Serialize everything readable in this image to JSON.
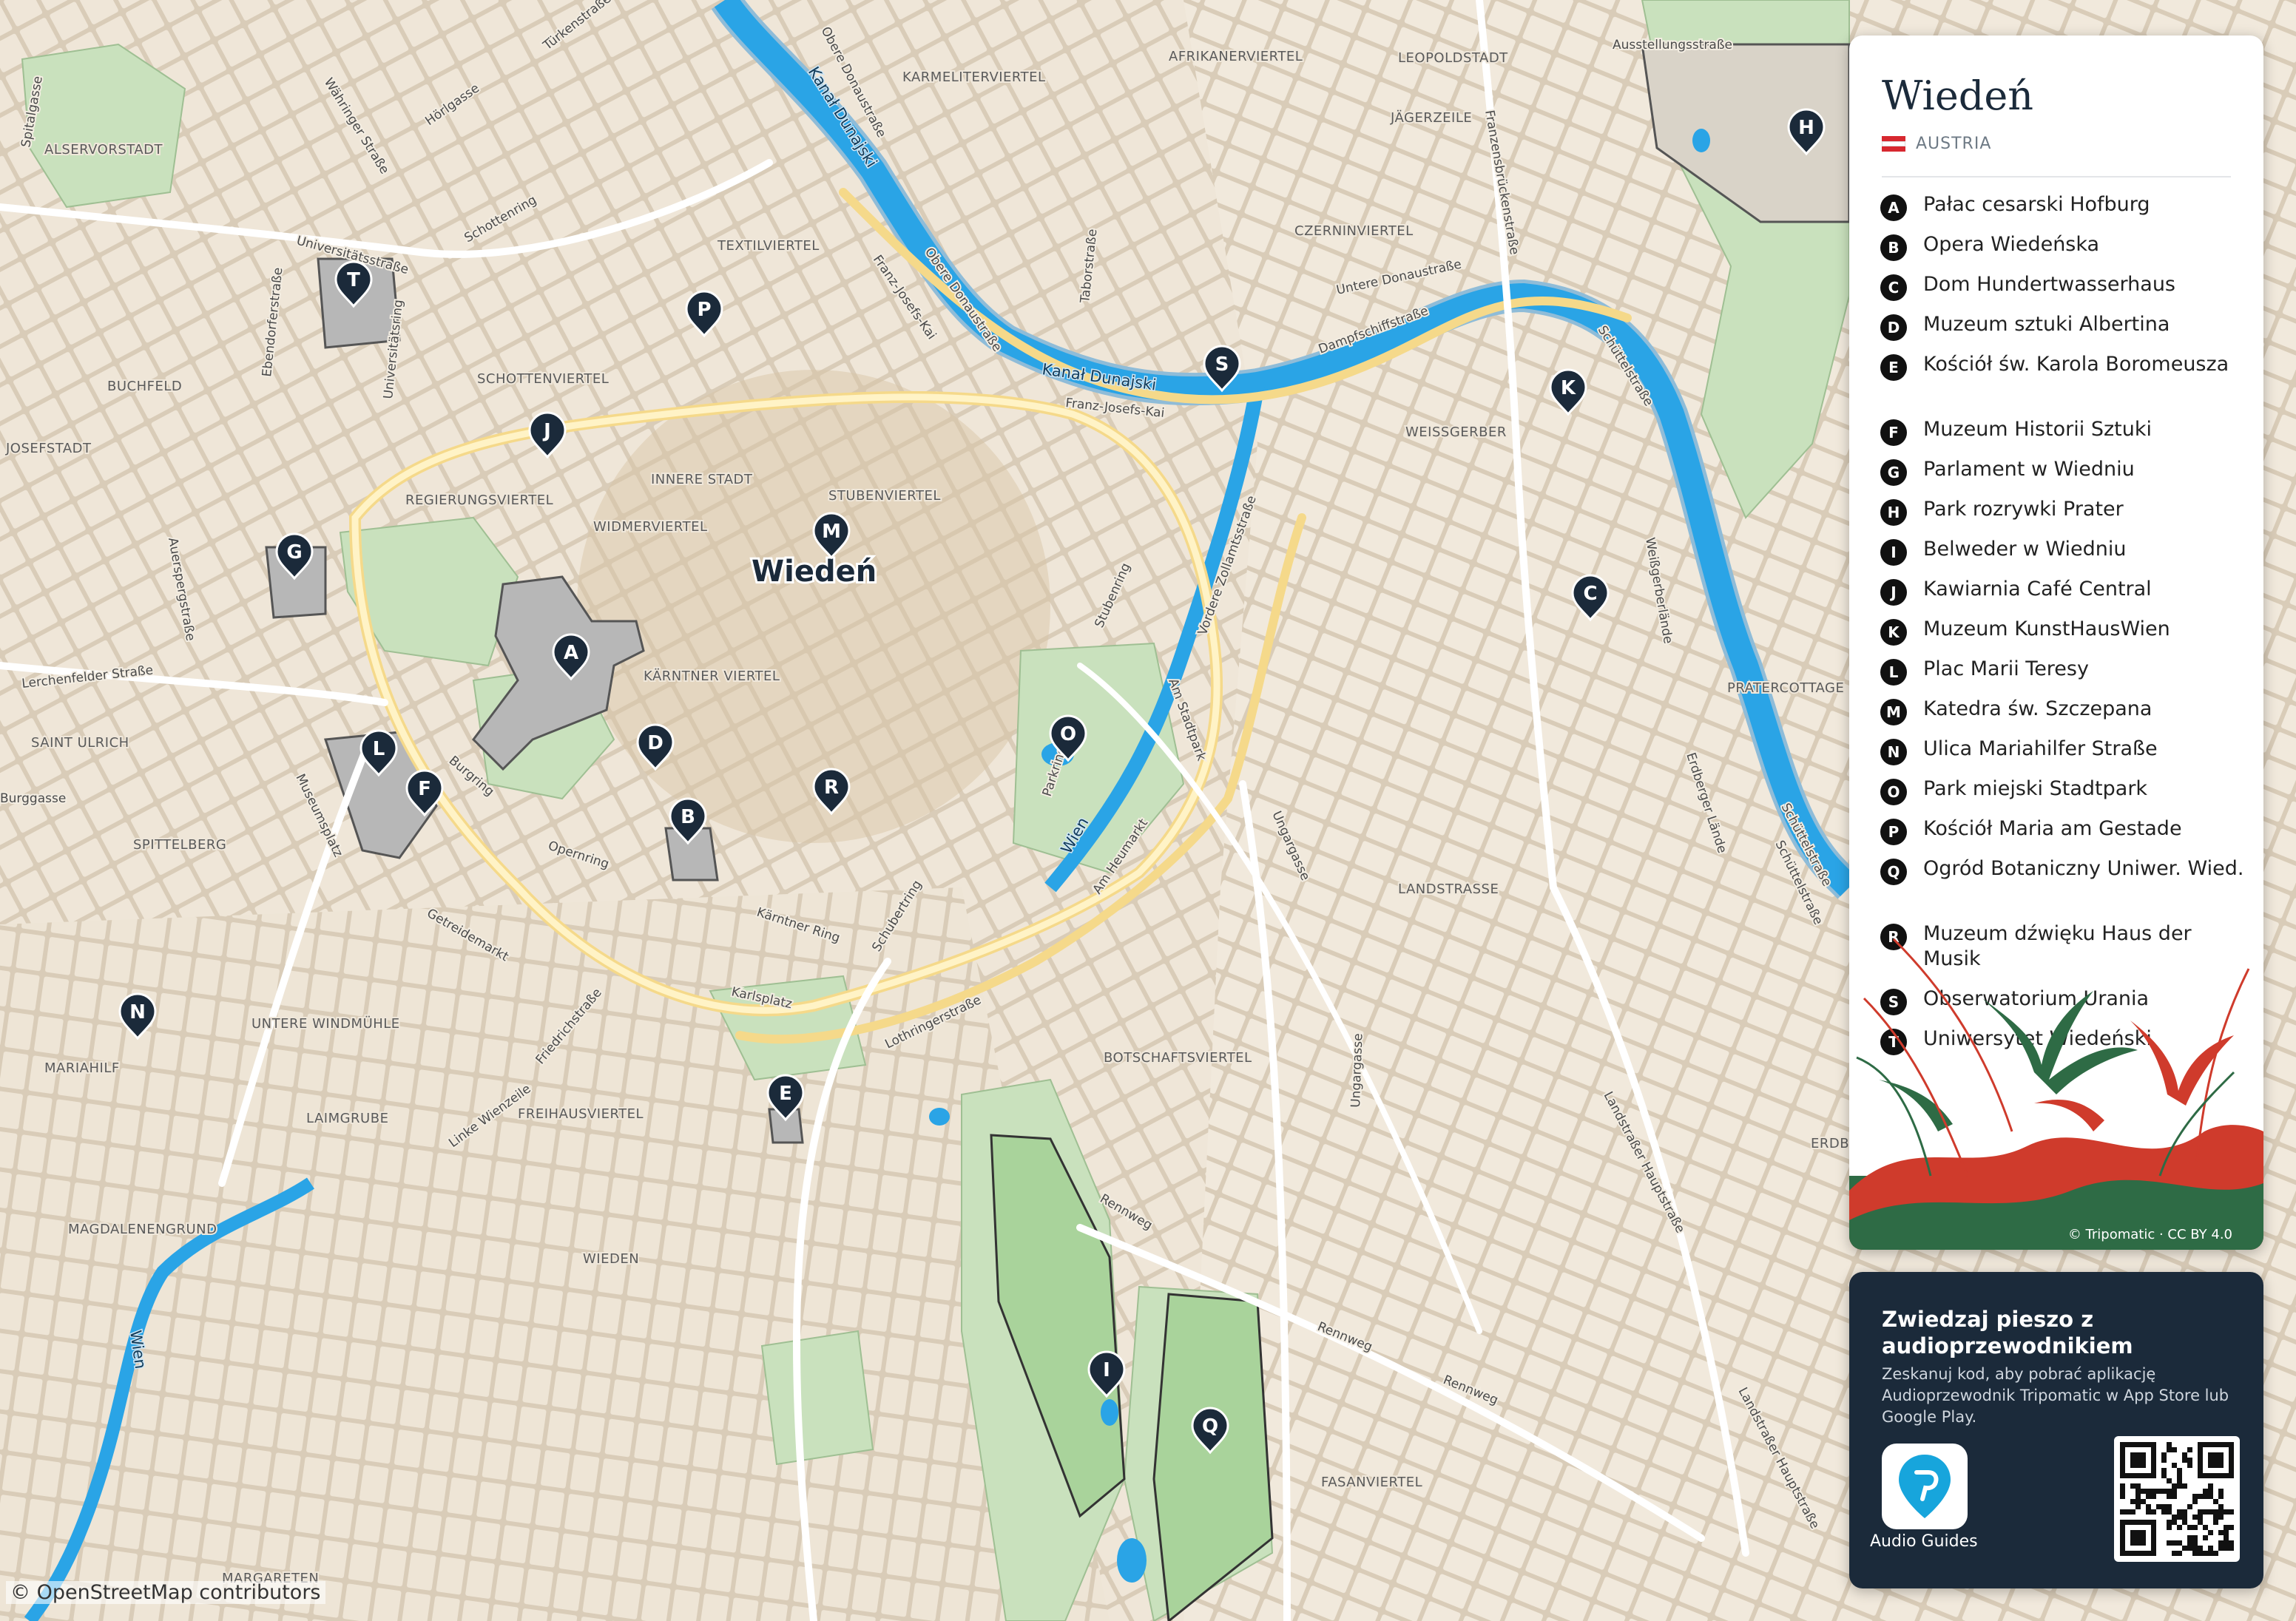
{
  "map": {
    "city_label": "Wiedeń",
    "attribution": "© OpenStreetMap contributors",
    "water_labels": [
      "Kanał Dunajski",
      "Kanał Dunajski",
      "Wien",
      "Wien"
    ],
    "district_labels": [
      "ALSERVORSTADT",
      "KARMELITERVIERTEL",
      "AFRIKANERVIERTEL",
      "LEOPOLDSTADT",
      "JÄGERZEILE",
      "TEXTILVIERTEL",
      "CZERNINVIERTEL",
      "BUCHFELD",
      "SCHOTTENVIERTEL",
      "JOSEFSTADT",
      "INNERE STADT",
      "WEISSGERBER",
      "REGIERUNGSVIERTEL",
      "STUBENVIERTEL",
      "WIDMERVIERTEL",
      "KÄRNTNER VIERTEL",
      "SAINT ULRICH",
      "SPITTELBERG",
      "LANDSTRASSE",
      "PRATERCOTTAGE",
      "UNTERE WINDMÜHLE",
      "MARIAHILF",
      "BOTSCHAFTSVIERTEL",
      "LAIMGRUBE",
      "FREIHAUSVIERTEL",
      "MAGDALENENGRUND",
      "WIEDEN",
      "FASANVIERTEL",
      "MARGARETEN",
      "ERDBE"
    ],
    "street_labels": [
      "Spitalgasse",
      "Türkenstraße",
      "Hörlgasse",
      "Obere Donaustraße",
      "Währinger Straße",
      "Universitätsstraße",
      "Schottenring",
      "Ebendorferstraße",
      "Universitätsring",
      "Franz-Josefs-Kai",
      "Obere Donaustraße",
      "Taborstraße",
      "Untere Donaustraße",
      "Franzensbrückenstraße",
      "Ausstellungsstraße",
      "Dampfschiffstraße",
      "Franz-Josefs-Kai",
      "Schüttelstraße",
      "Weißgerberlände",
      "Auerspergstraße",
      "Lerchenfelder Straße",
      "Parkring",
      "Stubenring",
      "Vordere Zollamtsstraße",
      "Am Stadtpark",
      "Burgring",
      "Museumsplatz",
      "Opernring",
      "Kärntner Ring",
      "Schubertring",
      "Am Heumarkt",
      "Ungargasse",
      "Getreidemarkt",
      "Friedrichstraße",
      "Karlsplatz",
      "Lothringerstraße",
      "Linke Wienzeile",
      "Schüttelstraße",
      "Erdberger Lände",
      "Rennweg",
      "Rennweg",
      "Rennweg",
      "Ungargasse",
      "Landstraßer Hauptstraße",
      "Landstraßer Hauptstraße",
      "Schüttelstraße",
      "Burggasse"
    ],
    "pins": [
      {
        "letter": "A"
      },
      {
        "letter": "B"
      },
      {
        "letter": "C"
      },
      {
        "letter": "D"
      },
      {
        "letter": "E"
      },
      {
        "letter": "F"
      },
      {
        "letter": "G"
      },
      {
        "letter": "H"
      },
      {
        "letter": "I"
      },
      {
        "letter": "J"
      },
      {
        "letter": "K"
      },
      {
        "letter": "L"
      },
      {
        "letter": "M"
      },
      {
        "letter": "N"
      },
      {
        "letter": "O"
      },
      {
        "letter": "P"
      },
      {
        "letter": "Q"
      },
      {
        "letter": "R"
      },
      {
        "letter": "S"
      },
      {
        "letter": "T"
      }
    ],
    "colors": {
      "land": "#e6dccd",
      "block": "#f3ede2",
      "park": "#cfe5c4",
      "water": "#2aa4e6",
      "road": "#ffffff",
      "major_road": "#fde9a8",
      "pin": "#1b2a3a"
    }
  },
  "panel": {
    "title": "Wiedeń",
    "country": "AUSTRIA",
    "flag_colors": [
      "#d7282f",
      "#ffffff",
      "#d7282f"
    ],
    "credit": "© Tripomatic · CC BY 4.0",
    "pois": [
      {
        "letter": "A",
        "name": "Pałac cesarski Hofburg"
      },
      {
        "letter": "B",
        "name": "Opera Wiedeńska"
      },
      {
        "letter": "C",
        "name": "Dom Hundertwasserhaus"
      },
      {
        "letter": "D",
        "name": "Muzeum sztuki Albertina"
      },
      {
        "letter": "E",
        "name": "Kościół św. Karola Boromeusza"
      },
      {
        "letter": "F",
        "name": "Muzeum Historii Sztuki"
      },
      {
        "letter": "G",
        "name": "Parlament w Wiedniu"
      },
      {
        "letter": "H",
        "name": "Park rozrywki Prater"
      },
      {
        "letter": "I",
        "name": "Belweder w Wiedniu"
      },
      {
        "letter": "J",
        "name": "Kawiarnia Café Central"
      },
      {
        "letter": "K",
        "name": "Muzeum KunstHausWien"
      },
      {
        "letter": "L",
        "name": "Plac Marii Teresy"
      },
      {
        "letter": "M",
        "name": "Katedra św. Szczepana"
      },
      {
        "letter": "N",
        "name": "Ulica Mariahilfer Straße"
      },
      {
        "letter": "O",
        "name": "Park miejski Stadtpark"
      },
      {
        "letter": "P",
        "name": "Kościół Maria am Gestade"
      },
      {
        "letter": "Q",
        "name": "Ogród Botaniczny Uniwer. Wied."
      },
      {
        "letter": "R",
        "name": "Muzeum dźwięku Haus der Musik"
      },
      {
        "letter": "S",
        "name": "Obserwatorium Urania"
      },
      {
        "letter": "T",
        "name": "Uniwersytet Wiedeński"
      }
    ]
  },
  "guide": {
    "title": "Zwiedzaj pieszo z audioprzewodnikiem",
    "text": "Zeskanuj kod, aby pobrać aplikację Audioprzewodnik Tripomatic w App Store lub Google Play.",
    "app_label": "Audio Guides",
    "app_icon": "map-pin-icon",
    "qr_icon": "qr-code-icon"
  }
}
